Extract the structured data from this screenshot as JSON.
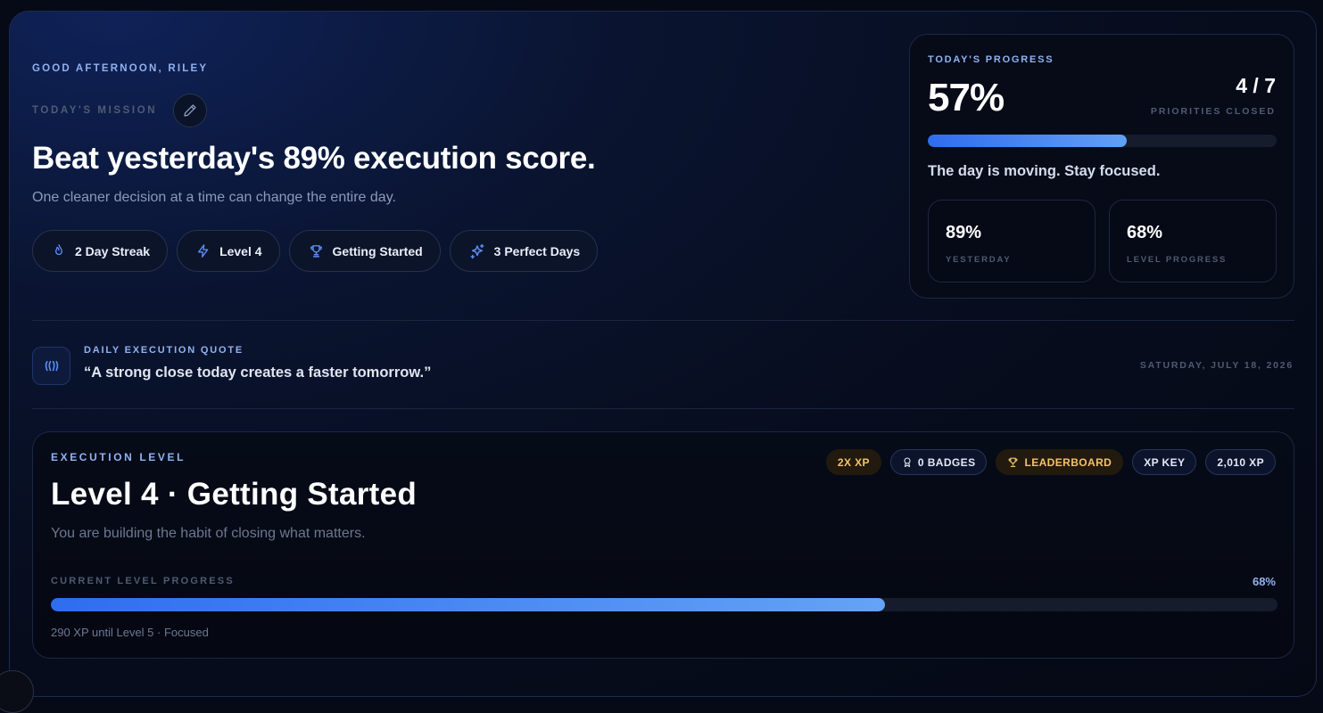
{
  "header": {
    "greeting": "GOOD AFTERNOON, RILEY",
    "mission_label": "TODAY'S MISSION",
    "headline": "Beat yesterday's 89% execution score.",
    "subline": "One cleaner decision at a time can change the entire day."
  },
  "chips": [
    {
      "label": "2 Day Streak",
      "icon": "flame-icon"
    },
    {
      "label": "Level 4",
      "icon": "lightning-icon"
    },
    {
      "label": "Getting Started",
      "icon": "trophy-icon"
    },
    {
      "label": "3 Perfect Days",
      "icon": "sparkles-icon"
    }
  ],
  "progress": {
    "label": "TODAY'S PROGRESS",
    "percent": "57%",
    "percent_value": 57,
    "ratio": "4 / 7",
    "ratio_label": "PRIORITIES CLOSED",
    "message": "The day is moving. Stay focused.",
    "yesterday_value": "89%",
    "yesterday_label": "YESTERDAY",
    "level_value": "68%",
    "level_label": "LEVEL PROGRESS"
  },
  "quote": {
    "label": "DAILY EXECUTION QUOTE",
    "text": "“A strong close today creates a faster tomorrow.”",
    "date": "SATURDAY, JULY 18, 2026"
  },
  "level": {
    "label": "EXECUTION LEVEL",
    "title": "Level 4 · Getting Started",
    "subtitle": "You are building the habit of closing what matters.",
    "badges": [
      {
        "label": "2X XP",
        "style": "gold",
        "icon": ""
      },
      {
        "label": "0 BADGES",
        "style": "blue",
        "icon": "medal-icon"
      },
      {
        "label": "LEADERBOARD",
        "style": "gold",
        "icon": "trophy-icon"
      },
      {
        "label": "XP KEY",
        "style": "blue",
        "icon": ""
      },
      {
        "label": "2,010 XP",
        "style": "blue",
        "icon": ""
      }
    ],
    "progress_label": "CURRENT LEVEL PROGRESS",
    "progress_pct": "68%",
    "progress_value": 68,
    "footer": "290 XP until Level 5 · Focused"
  },
  "colors": {
    "accent": "#8fb2f0",
    "bar_start": "#2f6df0",
    "bar_end": "#62a0f5",
    "gold": "#f2c46a"
  }
}
